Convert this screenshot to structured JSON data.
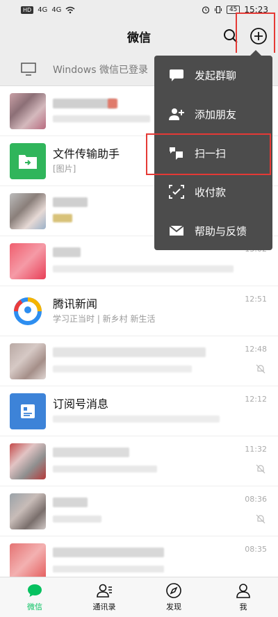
{
  "status_bar": {
    "left_badge": "HD",
    "network_1": "4G",
    "network_2": "4G",
    "battery": "45",
    "time": "15:23"
  },
  "header": {
    "title": "微信"
  },
  "windows_login": {
    "text": "Windows 微信已登录"
  },
  "chats": [
    {
      "name": "",
      "preview": "",
      "time": "",
      "muted": false
    },
    {
      "name": "文件传输助手",
      "preview": "[图片]",
      "time": "",
      "muted": false
    },
    {
      "name": "",
      "preview": "",
      "time": "",
      "muted": false
    },
    {
      "name": "",
      "preview": "",
      "time": "13:02",
      "muted": false
    },
    {
      "name": "腾讯新闻",
      "preview": "学习正当时 | 新乡村 新生活",
      "time": "12:51",
      "muted": false
    },
    {
      "name": "",
      "preview": "",
      "time": "12:48",
      "muted": true
    },
    {
      "name": "订阅号消息",
      "preview": "",
      "time": "12:12",
      "muted": false
    },
    {
      "name": "",
      "preview": "",
      "time": "11:32",
      "muted": true
    },
    {
      "name": "",
      "preview": "",
      "time": "08:36",
      "muted": true
    },
    {
      "name": "",
      "preview": "",
      "time": "08:35",
      "muted": false
    }
  ],
  "menu": {
    "items": [
      {
        "label": "发起群聊",
        "icon": "chat-bubble-icon"
      },
      {
        "label": "添加朋友",
        "icon": "add-friend-icon"
      },
      {
        "label": "扫一扫",
        "icon": "scan-icon"
      },
      {
        "label": "收付款",
        "icon": "pay-icon"
      },
      {
        "label": "帮助与反馈",
        "icon": "mail-icon"
      }
    ]
  },
  "nav": {
    "chats": "微信",
    "contacts": "通讯录",
    "discover": "发现",
    "me": "我"
  },
  "colors": {
    "accent": "#07c160",
    "menu_bg": "#4c4c4c",
    "highlight_box": "#e53935"
  }
}
